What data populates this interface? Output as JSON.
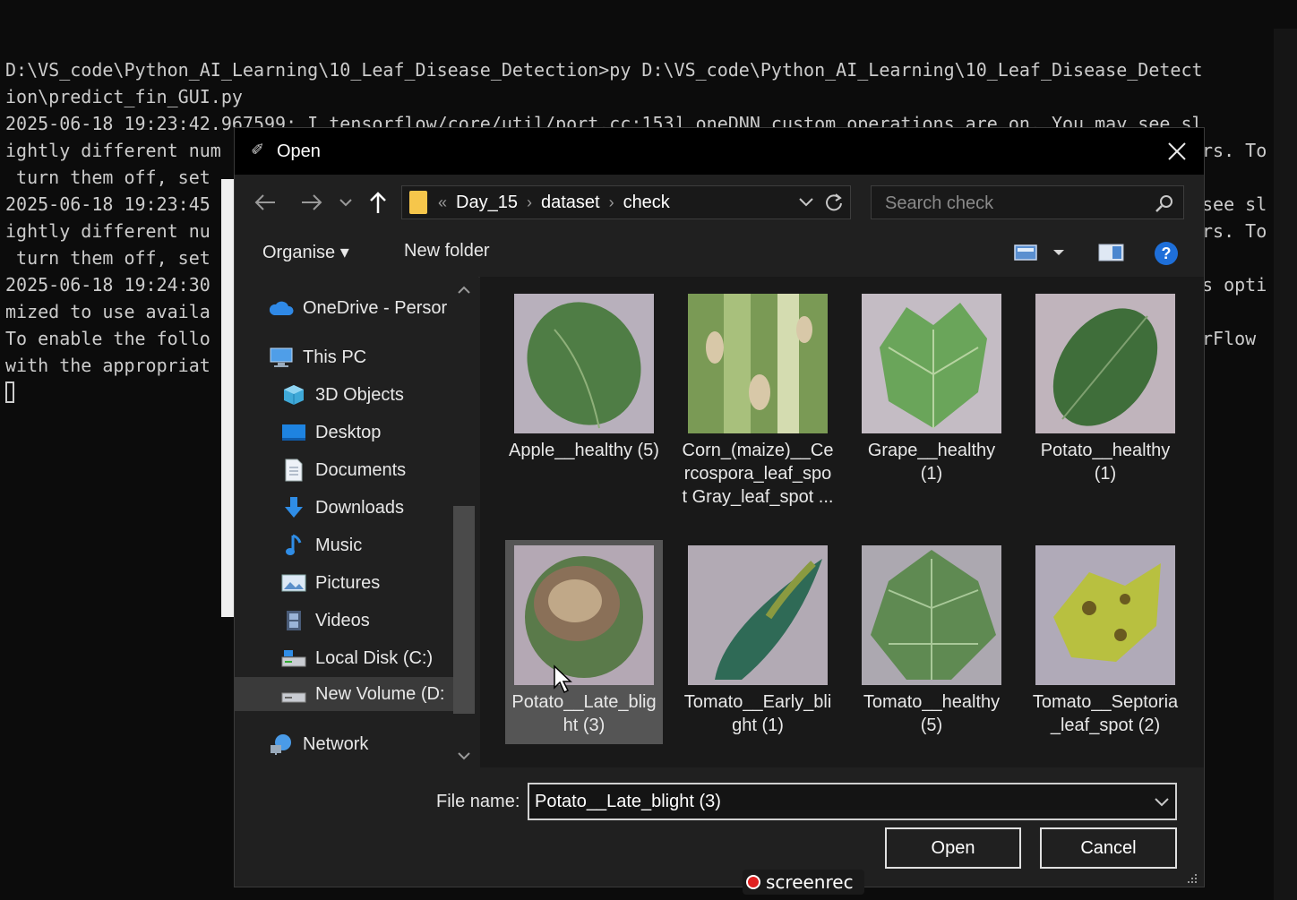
{
  "terminal": {
    "lines": [
      "D:\\VS_code\\Python_AI_Learning\\10_Leaf_Disease_Detection>py D:\\VS_code\\Python_AI_Learning\\10_Leaf_Disease_Detect",
      "ion\\predict_fin_GUI.py",
      "2025-06-18 19:23:42.967599: I tensorflow/core/util/port.cc:153] oneDNN custom operations are on. You may see sl",
      "ightly different num",
      " turn them off, set",
      "2025-06-18 19:23:45",
      "ightly different nu",
      " turn them off, set",
      "2025-06-18 19:24:30",
      "mized to use availa",
      "To enable the follo",
      "with the appropriat"
    ],
    "right_fragments": [
      "rs. To",
      "see sl",
      "rs. To",
      "s opti",
      "rFlow"
    ]
  },
  "dialog": {
    "title": "Open",
    "breadcrumb": [
      "Day_15",
      "dataset",
      "check"
    ],
    "breadcrumb_prefix": "«",
    "search_placeholder": "Search check",
    "toolbar": {
      "organise": "Organise ▾",
      "new_folder": "New folder"
    },
    "sidebar": [
      {
        "label": "OneDrive - Persor",
        "icon": "cloud-icon"
      },
      {
        "label": "This PC",
        "icon": "computer-icon"
      },
      {
        "label": "3D Objects",
        "icon": "cube-icon"
      },
      {
        "label": "Desktop",
        "icon": "desktop-icon"
      },
      {
        "label": "Documents",
        "icon": "document-icon"
      },
      {
        "label": "Downloads",
        "icon": "download-icon"
      },
      {
        "label": "Music",
        "icon": "music-icon"
      },
      {
        "label": "Pictures",
        "icon": "picture-icon"
      },
      {
        "label": "Videos",
        "icon": "video-icon"
      },
      {
        "label": "Local Disk (C:)",
        "icon": "drive-icon"
      },
      {
        "label": "New Volume (D:",
        "icon": "drive-icon"
      },
      {
        "label": "Network",
        "icon": "network-icon"
      }
    ],
    "files": [
      {
        "label": "Apple__healthy (5)"
      },
      {
        "label": "Corn_(maize)__Cercospora_leaf_spot Gray_leaf_spot ..."
      },
      {
        "label": "Grape__healthy (1)"
      },
      {
        "label": "Potato__healthy (1)"
      },
      {
        "label": "Potato__Late_blight (3)"
      },
      {
        "label": "Tomato__Early_blight (1)"
      },
      {
        "label": "Tomato__healthy (5)"
      },
      {
        "label": "Tomato__Septoria_leaf_spot (2)"
      }
    ],
    "file_name_label": "File name:",
    "file_name_value": "Potato__Late_blight (3)",
    "open_label": "Open",
    "cancel_label": "Cancel"
  },
  "overlay": {
    "recorder": "screenrec"
  },
  "colors": {
    "accent": "#3b8eea",
    "folder": "#f6c64b",
    "selection": "#555555"
  }
}
